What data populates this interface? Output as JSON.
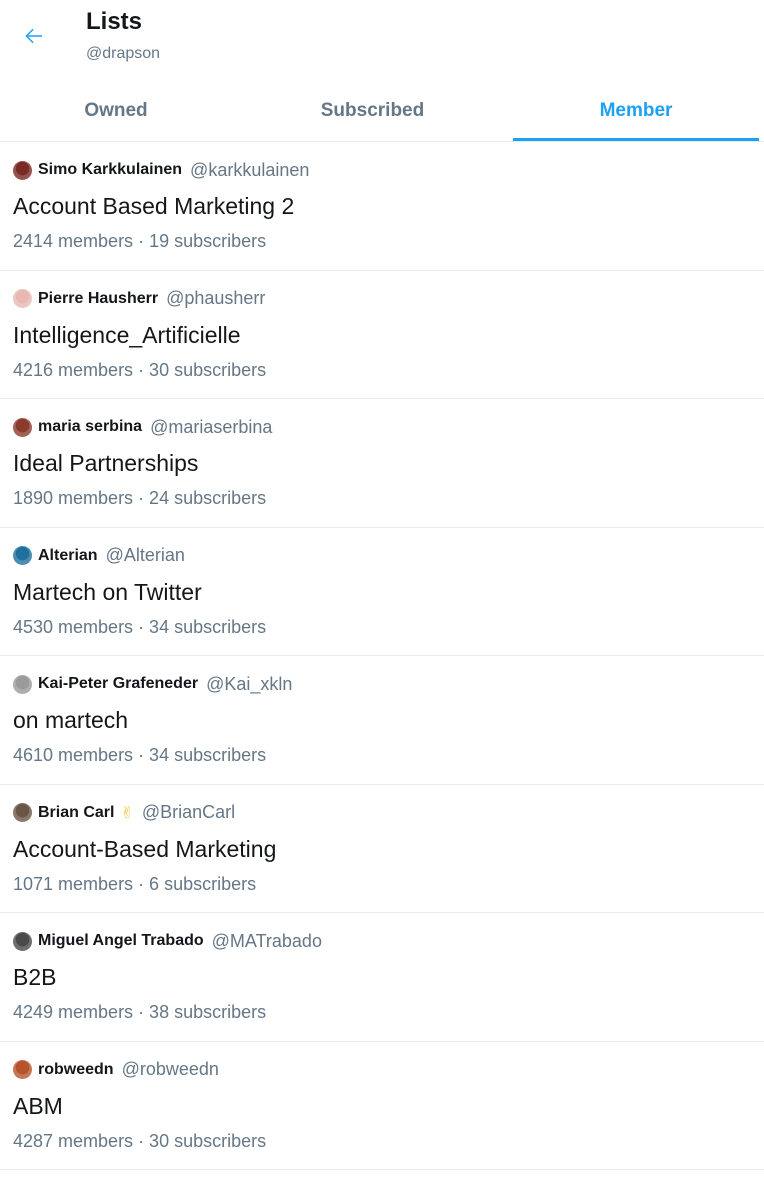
{
  "header": {
    "title": "Lists",
    "handle": "@drapson"
  },
  "tabs": [
    {
      "label": "Owned",
      "active": false
    },
    {
      "label": "Subscribed",
      "active": false
    },
    {
      "label": "Member",
      "active": true
    }
  ],
  "lists": [
    {
      "owner_name": "Simo Karkkulainen",
      "owner_handle": "@karkkulainen",
      "name": "Account Based Marketing 2",
      "stats": "2414 members · 19 subscribers",
      "avatar_color": "#7a2a22"
    },
    {
      "owner_name": "Pierre Hausherr",
      "owner_handle": "@phausherr",
      "name": "Intelligence_Artificielle",
      "stats": "4216 members · 30 subscribers",
      "avatar_color": "#e7b9b0"
    },
    {
      "owner_name": "maria serbina",
      "owner_handle": "@mariaserbina",
      "name": "Ideal Partnerships",
      "stats": "1890 members · 24 subscribers",
      "avatar_color": "#8a3b2c"
    },
    {
      "owner_name": "Alterian",
      "owner_handle": "@Alterian",
      "name": "Martech on Twitter",
      "stats": "4530 members · 34 subscribers",
      "avatar_color": "#1f6f9f"
    },
    {
      "owner_name": "Kai-Peter Grafeneder",
      "owner_handle": "@Kai_xkln",
      "name": "on martech",
      "stats": "4610 members · 34 subscribers",
      "avatar_color": "#9a9a9a"
    },
    {
      "owner_name": "Brian Carl",
      "owner_handle": "@BrianCarl",
      "name": "Account-Based Marketing",
      "stats": "1071 members · 6 subscribers",
      "avatar_color": "#6b5646",
      "emoji": "✌"
    },
    {
      "owner_name": "Miguel Angel Trabado",
      "owner_handle": "@MATrabado",
      "name": "B2B",
      "stats": "4249 members · 38 subscribers",
      "avatar_color": "#4a4a4a"
    },
    {
      "owner_name": "robweedn",
      "owner_handle": "@robweedn",
      "name": "ABM",
      "stats": "4287 members · 30 subscribers",
      "avatar_color": "#b5532b"
    }
  ],
  "colors": {
    "accent": "#1da1f2",
    "secondary_text": "#657786",
    "divider": "#e6ecf0"
  }
}
